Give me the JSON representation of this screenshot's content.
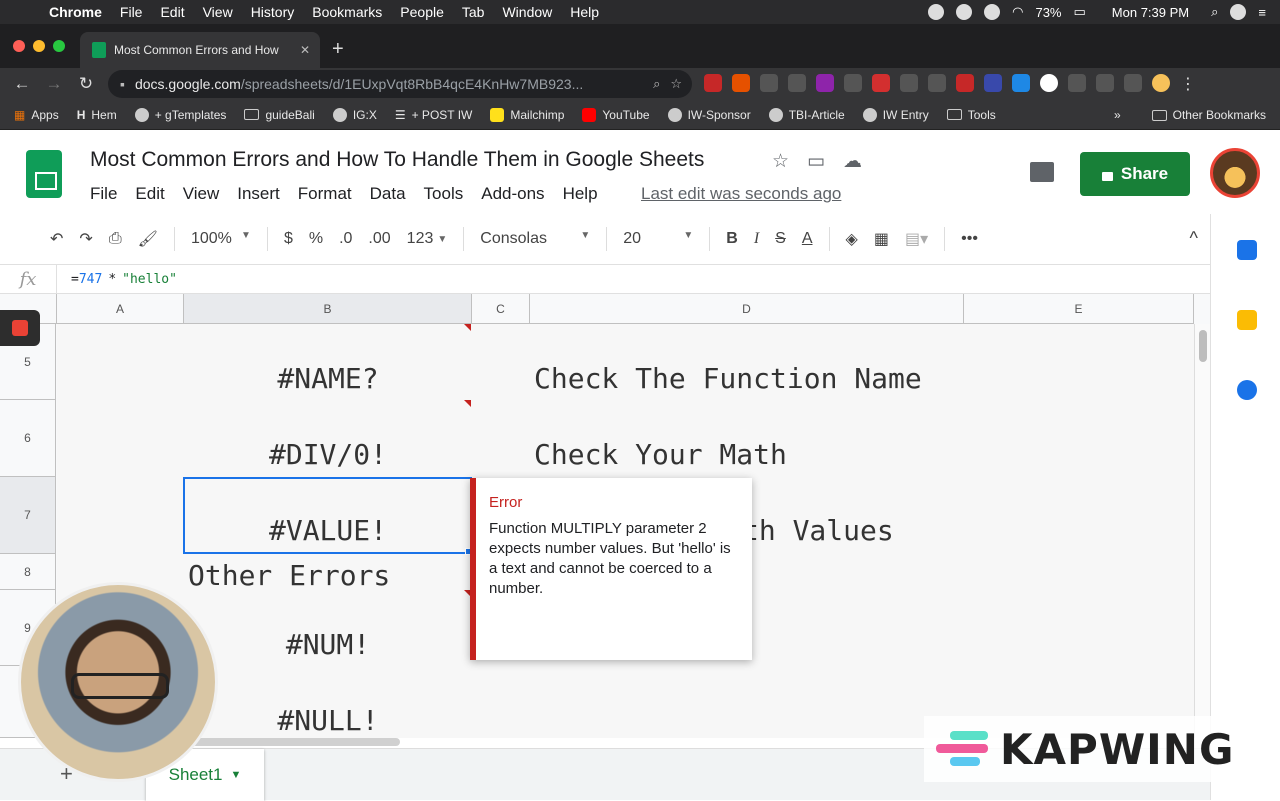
{
  "menubar": {
    "app": "Chrome",
    "items": [
      "File",
      "Edit",
      "View",
      "History",
      "Bookmarks",
      "People",
      "Tab",
      "Window",
      "Help"
    ],
    "battery": "73%",
    "clock": "Mon 7:39 PM"
  },
  "browser": {
    "tab_title": "Most Common Errors and How",
    "url_host": "docs.google.com",
    "url_path": "/spreadsheets/d/1EUxpVqt8RbB4qcE4KnHw7MB923..."
  },
  "bookmarks": {
    "items": [
      "Apps",
      "Hem",
      "+ gTemplates",
      "guideBali",
      "IG:X",
      "+ POST IW",
      "Mailchimp",
      "YouTube",
      "IW-Sponsor",
      "TBI-Article",
      "IW Entry",
      "Tools"
    ],
    "overflow": "»",
    "other": "Other Bookmarks"
  },
  "doc": {
    "title": "Most Common Errors and How To Handle Them in Google Sheets",
    "menu": [
      "File",
      "Edit",
      "View",
      "Insert",
      "Format",
      "Data",
      "Tools",
      "Add-ons",
      "Help"
    ],
    "last_edit": "Last edit was seconds ago",
    "share_label": "Share"
  },
  "toolbar": {
    "zoom": "100%",
    "currency": "$",
    "percent": "%",
    "dec_less": ".0",
    "dec_more": ".00",
    "more_formats": "123",
    "font": "Consolas",
    "font_size": "20",
    "bold": "B",
    "italic": "I",
    "strike": "S",
    "text_color": "A",
    "more": "•••",
    "collapse": "^"
  },
  "formula_bar": {
    "fx": "fx",
    "eq": "=",
    "num": "747",
    "op": "*",
    "str": "\"hello\""
  },
  "grid": {
    "columns": [
      "A",
      "B",
      "C",
      "D",
      "E"
    ],
    "rows": [
      "5",
      "6",
      "7",
      "8",
      "9"
    ],
    "cells": {
      "b5": "#NAME?",
      "d5": "Check The Function Name",
      "b6": "#DIV/0!",
      "d6": "Check Your Math",
      "b7": "#VALUE!",
      "d7_visible": "th Values",
      "a8": "Other Errors",
      "b9": "#NUM!",
      "b10": "#NULL!"
    }
  },
  "error_tooltip": {
    "title": "Error",
    "body": "Function MULTIPLY parameter 2 expects number values. But 'hello' is a text and cannot be coerced to a number."
  },
  "sheets": {
    "add": "+",
    "active_tab": "Sheet1"
  },
  "watermark": {
    "text": "KAPWING"
  },
  "colors": {
    "sheets_green": "#188038",
    "error_red": "#c5221f",
    "selection_blue": "#1a73e8"
  }
}
